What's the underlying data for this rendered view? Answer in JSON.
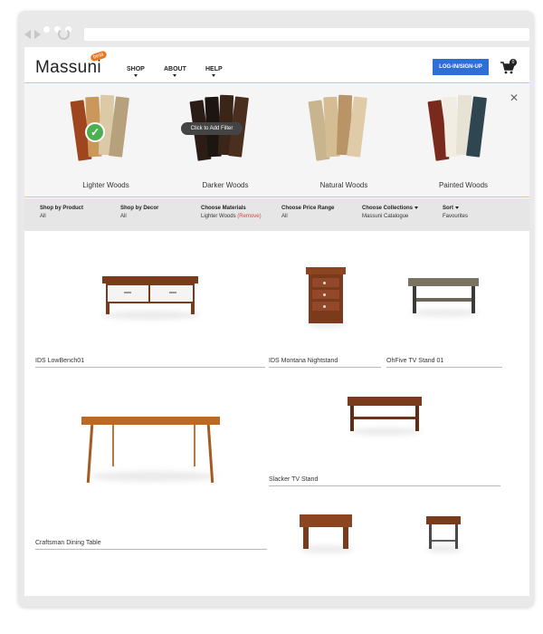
{
  "brand": {
    "logo_text": "Massuni",
    "badge": "beta"
  },
  "nav": {
    "shop": "SHOP",
    "about": "ABOUT",
    "help": "HELP"
  },
  "login_label": "LOG-IN/SIGN-UP",
  "cart_count": "0",
  "filters": {
    "swatches": [
      {
        "label": "Lighter Woods",
        "selected": true
      },
      {
        "label": "Darker Woods",
        "selected": false
      },
      {
        "label": "Natural Woods",
        "selected": false
      },
      {
        "label": "Painted Woods",
        "selected": false
      }
    ],
    "tooltip": "Click to Add Filter",
    "close_icon": "close-icon"
  },
  "filter_bar": {
    "product": {
      "title": "Shop by Product",
      "value": "All"
    },
    "decor": {
      "title": "Shop by Decor",
      "value": "All"
    },
    "materials": {
      "title": "Choose Materials",
      "value": "Lighter Woods",
      "remove": "(Remove)"
    },
    "price": {
      "title": "Choose Price Range",
      "value": "All"
    },
    "collections": {
      "title": "Choose Collections",
      "value": "Massuni Catalogue"
    },
    "sort": {
      "title": "Sort",
      "value": "Favourites"
    }
  },
  "products": [
    {
      "name": "IDS LowBench01"
    },
    {
      "name": "IDS Montana Nightstand"
    },
    {
      "name": "OhFive TV Stand 01"
    },
    {
      "name": "Slacker TV Stand"
    },
    {
      "name": "Craftsman Dining Table"
    }
  ],
  "colors": {
    "accent": "#e87722",
    "login": "#2e6fd6",
    "check": "#4caf50",
    "remove": "#e04040"
  }
}
